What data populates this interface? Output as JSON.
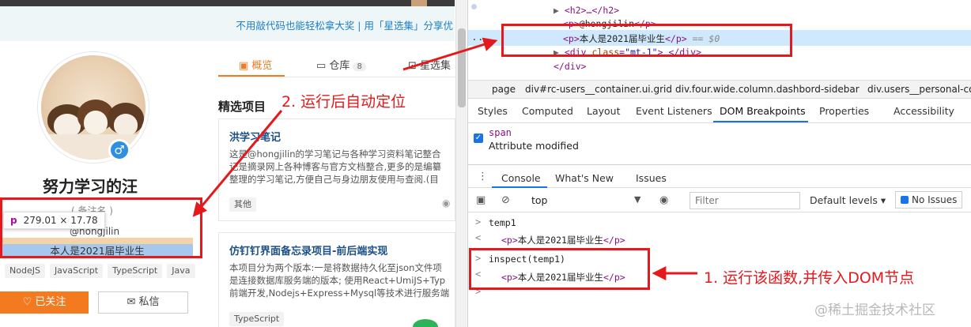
{
  "profile": {
    "banner_text": "不用敲代码也能轻松拿大奖 | 用「星选集」分享优",
    "username": "努力学习的汪",
    "note": "( 备注名 )",
    "handle": "@hongjilin",
    "bio": "本人是2021届毕业生",
    "tags": [
      "NodeJS",
      "JavaScript",
      "TypeScript",
      "Java"
    ],
    "follow_label": "已关注",
    "message_label": "私信",
    "tooltip": {
      "tag": "p",
      "dims": "279.01 × 17.78"
    }
  },
  "tabs": [
    {
      "label": "概览"
    },
    {
      "label": "仓库",
      "count": "8"
    },
    {
      "label": "星选集"
    }
  ],
  "projects": {
    "section_title": "精选项目",
    "cards": [
      {
        "title": "洪学习笔记",
        "desc": [
          "这是@hongjilin的学习笔记与各种学习资料笔记整合",
          "记是摘录网上各种博客与官方文档整合,更多的是编纂",
          "整理的学习笔记,方便自己与身边朋友使用与查阅.(目"
        ],
        "tag": "其他"
      },
      {
        "title": "仿钉钉界面备忘录项目-前后端实现",
        "desc": [
          "本项目分为两个版本:一是将数据持久化至json文件项",
          "是连接数据库服务端的版本; 使用React+UmiJS+Typ",
          "前端开发,Nodejs+Express+Mysql等技术进行服务端"
        ],
        "tag": "TypeScript"
      }
    ]
  },
  "devtools": {
    "dom_lines": {
      "h2": "<h2>…</h2>",
      "p_handle_open": "<p>",
      "p_handle_text": "@hongjilin",
      "p_handle_close": "</p>",
      "p_sel_open": "<p>",
      "p_sel_text": "本人是2021届毕业生",
      "p_sel_close": "</p>",
      "p_sel_eq": "== $0",
      "div_open": "<div",
      "div_attr": "class",
      "div_val": "\"mt-1\"",
      "div_rest": "> </div>",
      "div_close": "</div>",
      "dots": "..."
    },
    "breadcrumbs": [
      "page",
      "div#rc-users__container.ui.grid",
      "div.four.wide.column.dashbord-sidebar",
      "div.users__personal-co"
    ],
    "subtabs": [
      "Styles",
      "Computed",
      "Layout",
      "Event Listeners",
      "DOM Breakpoints",
      "Properties",
      "Accessibility"
    ],
    "breakpoint": {
      "tag": "span",
      "desc": "Attribute modified"
    },
    "drawer_tabs": [
      "Console",
      "What's New",
      "Issues"
    ],
    "context": "top",
    "filter_placeholder": "Filter",
    "levels": "Default levels ▾",
    "issues": "No Issues",
    "console": {
      "in1": "temp1",
      "out1_open": "<p>",
      "out1_text": "本人是2021届毕业生",
      "out1_close": "</p>",
      "in2": "inspect(temp1)",
      "out2_open": "<p>",
      "out2_text": "本人是2021届毕业生",
      "out2_close": "</p>"
    }
  },
  "annotations": {
    "step1": "1. 运行该函数,并传入DOM节点",
    "step2": "2. 运行后自动定位",
    "color": "#e5191c"
  },
  "watermark": "@稀土掘金技术社区"
}
